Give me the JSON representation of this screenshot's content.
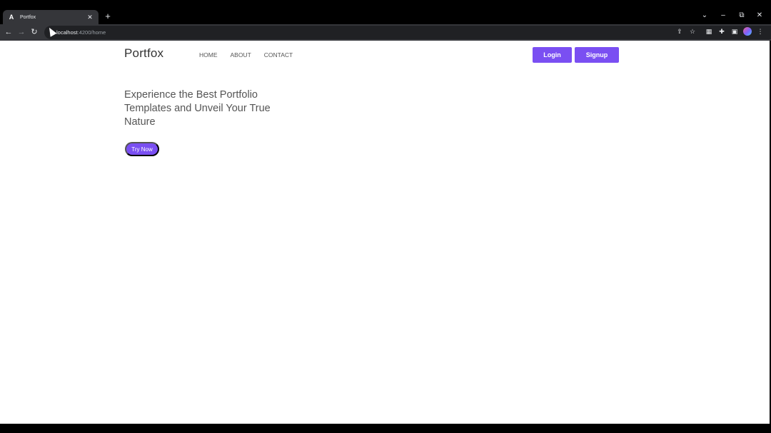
{
  "browser": {
    "tab": {
      "title": "Portfox",
      "favicon": "A"
    },
    "url": {
      "host": "localhost",
      "path": ":4200/home"
    },
    "new_tab": "+",
    "close_tab": "✕",
    "icons": {
      "back": "←",
      "forward": "→",
      "reload": "↻",
      "share": "⇪",
      "star": "☆",
      "extensions1": "▦",
      "puzzle": "✚",
      "sidebar": "▣",
      "menu": "⋮",
      "chevron": "⌄",
      "minimize": "–",
      "restore": "⧉",
      "close": "✕"
    }
  },
  "page": {
    "brand": "Portfox",
    "nav": [
      "HOME",
      "ABOUT",
      "CONTACT"
    ],
    "login": "Login",
    "signup": "Signup",
    "hero_title": "Experience the Best Portfolio Templates and Unveil Your True Nature",
    "cta": "Try Now",
    "accent_color": "#7a4ff2"
  }
}
